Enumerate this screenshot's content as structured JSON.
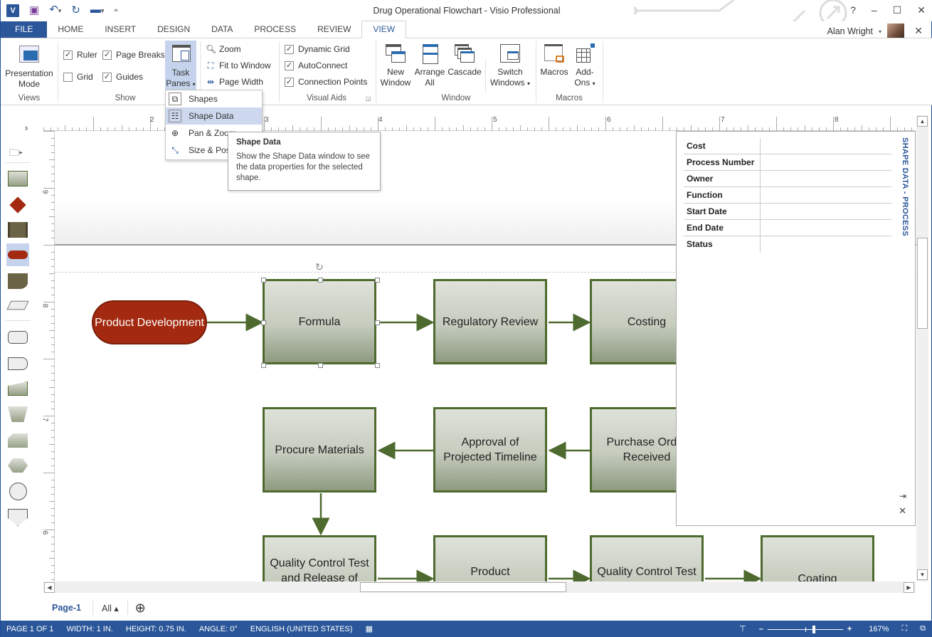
{
  "window": {
    "title": "Drug Operational Flowchart - Visio Professional",
    "help": "?",
    "minimize": "–",
    "maximize": "☐",
    "close": "✕"
  },
  "qat": {
    "app_icon": "V",
    "save_icon": "save-icon",
    "undo_icon": "undo-icon",
    "redo_icon": "redo-icon",
    "customize_icon": "customize-icon"
  },
  "tabs": [
    "FILE",
    "HOME",
    "INSERT",
    "DESIGN",
    "DATA",
    "PROCESS",
    "REVIEW",
    "VIEW"
  ],
  "active_tab": "VIEW",
  "user": {
    "name": "Alan Wright"
  },
  "ribbon": {
    "views": {
      "label": "Views",
      "presentation_mode": "Presentation Mode"
    },
    "show": {
      "label": "Show",
      "ruler": {
        "label": "Ruler",
        "checked": true
      },
      "page_breaks": {
        "label": "Page Breaks",
        "checked": true
      },
      "grid": {
        "label": "Grid",
        "checked": false
      },
      "guides": {
        "label": "Guides",
        "checked": true
      },
      "task_panes": "Task Panes"
    },
    "zoom": {
      "zoom": "Zoom",
      "fit_to_window": "Fit to Window",
      "page_width": "Page Width"
    },
    "visual_aids": {
      "label": "Visual Aids",
      "dynamic_grid": {
        "label": "Dynamic Grid",
        "checked": true
      },
      "autoconnect": {
        "label": "AutoConnect",
        "checked": true
      },
      "connection_points": {
        "label": "Connection Points",
        "checked": true
      }
    },
    "window": {
      "label": "Window",
      "new_window": "New Window",
      "arrange_all": "Arrange All",
      "cascade": "Cascade",
      "switch_windows": "Switch Windows"
    },
    "macros": {
      "label": "Macros",
      "macros": "Macros",
      "add_ons": "Add-Ons"
    }
  },
  "task_panes_menu": {
    "items": [
      "Shapes",
      "Shape Data",
      "Pan & Zoom",
      "Size & Position"
    ],
    "highlighted": "Shape Data"
  },
  "tooltip": {
    "title": "Shape Data",
    "body": "Show the Shape Data window to see the data properties for the selected shape."
  },
  "rulers": {
    "horizontal": [
      "2",
      "3",
      "4",
      "5",
      "6",
      "7",
      "8"
    ],
    "vertical": [
      "9",
      "8",
      "7",
      "6"
    ]
  },
  "flowchart": {
    "terminator": "Product Development",
    "processes": [
      "Formula",
      "Regulatory Review",
      "Costing",
      "Procure Materials",
      "Approval of Projected Timeline",
      "Purchase Order Received",
      "Quality Control Test and Release of",
      "Product",
      "Quality Control Test",
      "Coating"
    ],
    "selected": "Formula"
  },
  "shape_data": {
    "title": "SHAPE DATA - PROCESS",
    "fields": [
      {
        "key": "Cost",
        "value": ""
      },
      {
        "key": "Process Number",
        "value": ""
      },
      {
        "key": "Owner",
        "value": ""
      },
      {
        "key": "Function",
        "value": ""
      },
      {
        "key": "Start Date",
        "value": ""
      },
      {
        "key": "End Date",
        "value": ""
      },
      {
        "key": "Status",
        "value": ""
      }
    ]
  },
  "page_tabs": {
    "current": "Page-1",
    "all": "All ▴",
    "add": "⊕"
  },
  "status": {
    "page": "PAGE 1 OF 1",
    "width": "WIDTH: 1 IN.",
    "height": "HEIGHT: 0.75 IN.",
    "angle": "ANGLE: 0°",
    "language": "ENGLISH (UNITED STATES)",
    "zoom_level": "167%",
    "zoom_fraction": 0.6
  },
  "colors": {
    "accent": "#2b579a",
    "process_border": "#4e6a2e",
    "terminator_fill": "#a32a10"
  }
}
